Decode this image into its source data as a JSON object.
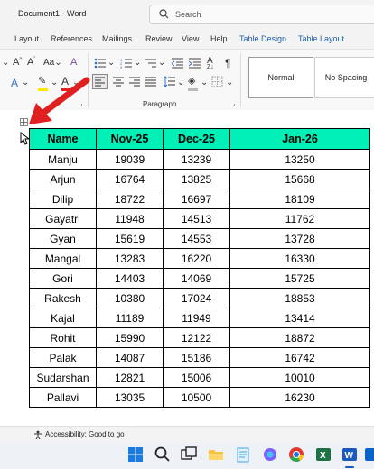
{
  "title": "Document1  -  Word",
  "search": {
    "placeholder": "Search"
  },
  "menu_tabs": [
    "Layout",
    "References",
    "Mailings",
    "Review",
    "View",
    "Help",
    "Table Design",
    "Table Layout"
  ],
  "ribbon": {
    "paragraph_label": "Paragraph",
    "styles": [
      "Normal",
      "No Spacing"
    ],
    "font_color_label": "A",
    "aa_label": "Aa",
    "highlight_label": "A"
  },
  "table": {
    "headers": [
      "Name",
      "Nov-25",
      "Dec-25",
      "Jan-26"
    ],
    "rows": [
      [
        "Manju",
        "19039",
        "13239",
        "13250"
      ],
      [
        "Arjun",
        "16764",
        "13825",
        "15668"
      ],
      [
        "Dilip",
        "18722",
        "16697",
        "18109"
      ],
      [
        "Gayatri",
        "11948",
        "14513",
        "11762"
      ],
      [
        "Gyan",
        "15619",
        "14553",
        "13728"
      ],
      [
        "Mangal",
        "13283",
        "16220",
        "16330"
      ],
      [
        "Gori",
        "14403",
        "14069",
        "15725"
      ],
      [
        "Rakesh",
        "10380",
        "17024",
        "18853"
      ],
      [
        "Kajal",
        "11189",
        "11949",
        "13414"
      ],
      [
        "Rohit",
        "15990",
        "12122",
        "18872"
      ],
      [
        "Palak",
        "14087",
        "15186",
        "16742"
      ],
      [
        "Sudarshan",
        "12821",
        "15006",
        "10010"
      ],
      [
        "Pallavi",
        "13035",
        "10500",
        "16230"
      ]
    ]
  },
  "status": {
    "accessibility": "Accessibility: Good to go"
  },
  "colors": {
    "header_fill": "#00f0b7",
    "arrow": "#e02020",
    "accent": "#1f5ea8"
  },
  "taskbar_icons": [
    "windows-start-icon",
    "search-icon",
    "task-view-icon",
    "file-explorer-icon",
    "notepad-icon",
    "copilot-icon",
    "chrome-icon",
    "excel-icon",
    "word-icon",
    "outlook-icon"
  ]
}
